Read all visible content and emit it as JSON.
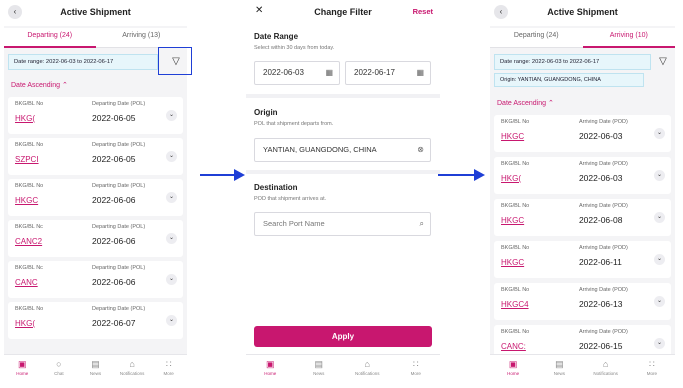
{
  "screen1": {
    "title": "Active Shipment",
    "tabs": [
      "Departing (24)",
      "Arriving (13)"
    ],
    "date_range": "Date range: 2022-06-03 to 2022-06-17",
    "sort_label": "Date Ascending",
    "cards": [
      {
        "label": "BKG/BL No",
        "number": "HKG(",
        "date_label": "Departing Date (POL)",
        "date": "2022-06-05"
      },
      {
        "label": "BKG/BL No",
        "number": "SZPCI",
        "date_label": "Departing Date (POL)",
        "date": "2022-06-05"
      },
      {
        "label": "BKG/BL No",
        "number": "HKGC",
        "date_label": "Departing Date (POL)",
        "date": "2022-06-06"
      },
      {
        "label": "BKG/BL Nc",
        "number": "CANC2",
        "date_label": "Departing Date (POL)",
        "date": "2022-06-06"
      },
      {
        "label": "BKG/BL Nc",
        "number": "CANC",
        "date_label": "Departing Date (POL)",
        "date": "2022-06-06"
      },
      {
        "label": "BKG/BL No",
        "number": "HKG(",
        "date_label": "Departing Date (POL)",
        "date": "2022-06-07"
      }
    ]
  },
  "screen2": {
    "title": "Change Filter",
    "reset": "Reset",
    "date_title": "Date Range",
    "date_sub": "Select within 30 days from today.",
    "date_from": "2022-06-03",
    "date_to": "2022-06-17",
    "origin_title": "Origin",
    "origin_sub": "POL that shipment departs from.",
    "origin_value": "YANTIAN, GUANGDONG, CHINA",
    "dest_title": "Destination",
    "dest_sub": "POD that shipment arrives at.",
    "dest_placeholder": "Search Port Name",
    "apply": "Apply"
  },
  "screen3": {
    "title": "Active Shipment",
    "tabs": [
      "Departing (24)",
      "Arriving (10)"
    ],
    "date_range": "Date range: 2022-06-03 to 2022-06-17",
    "origin": "Origin: YANTIAN, GUANGDONG, CHINA",
    "sort_label": "Date Ascending",
    "cards": [
      {
        "label": "BKG/BL No",
        "number": "HKGC",
        "date_label": "Arriving Date (POD)",
        "date": "2022-06-03"
      },
      {
        "label": "BKG/BL No",
        "number": "HKG(",
        "date_label": "Arriving Date (POD)",
        "date": "2022-06-03"
      },
      {
        "label": "BKG/BL No",
        "number": "HKGC",
        "date_label": "Arriving Date (POD)",
        "date": "2022-06-08"
      },
      {
        "label": "BKG/BL No",
        "number": "HKGC",
        "date_label": "Arriving Date (POD)",
        "date": "2022-06-11"
      },
      {
        "label": "BKG/BL No",
        "number": "HKGC4",
        "date_label": "Arriving Date (POD)",
        "date": "2022-06-13"
      },
      {
        "label": "BKG/BL No",
        "number": "CANC:",
        "date_label": "Arriving Date (POD)",
        "date": "2022-06-15"
      }
    ]
  },
  "nav4": [
    "Home",
    "Chat",
    "News",
    "Notifications",
    "More"
  ],
  "nav_short": [
    "Home",
    "News",
    "Notifications",
    "More"
  ],
  "icons": {
    "back": "chevron-left-icon",
    "filter": "funnel-icon",
    "calendar": "calendar-icon",
    "clear": "clear-icon",
    "search": "search-icon"
  },
  "colors": {
    "accent": "#c8176f",
    "highlight": "#1f3fd6",
    "chip": "#e7f6fb"
  }
}
